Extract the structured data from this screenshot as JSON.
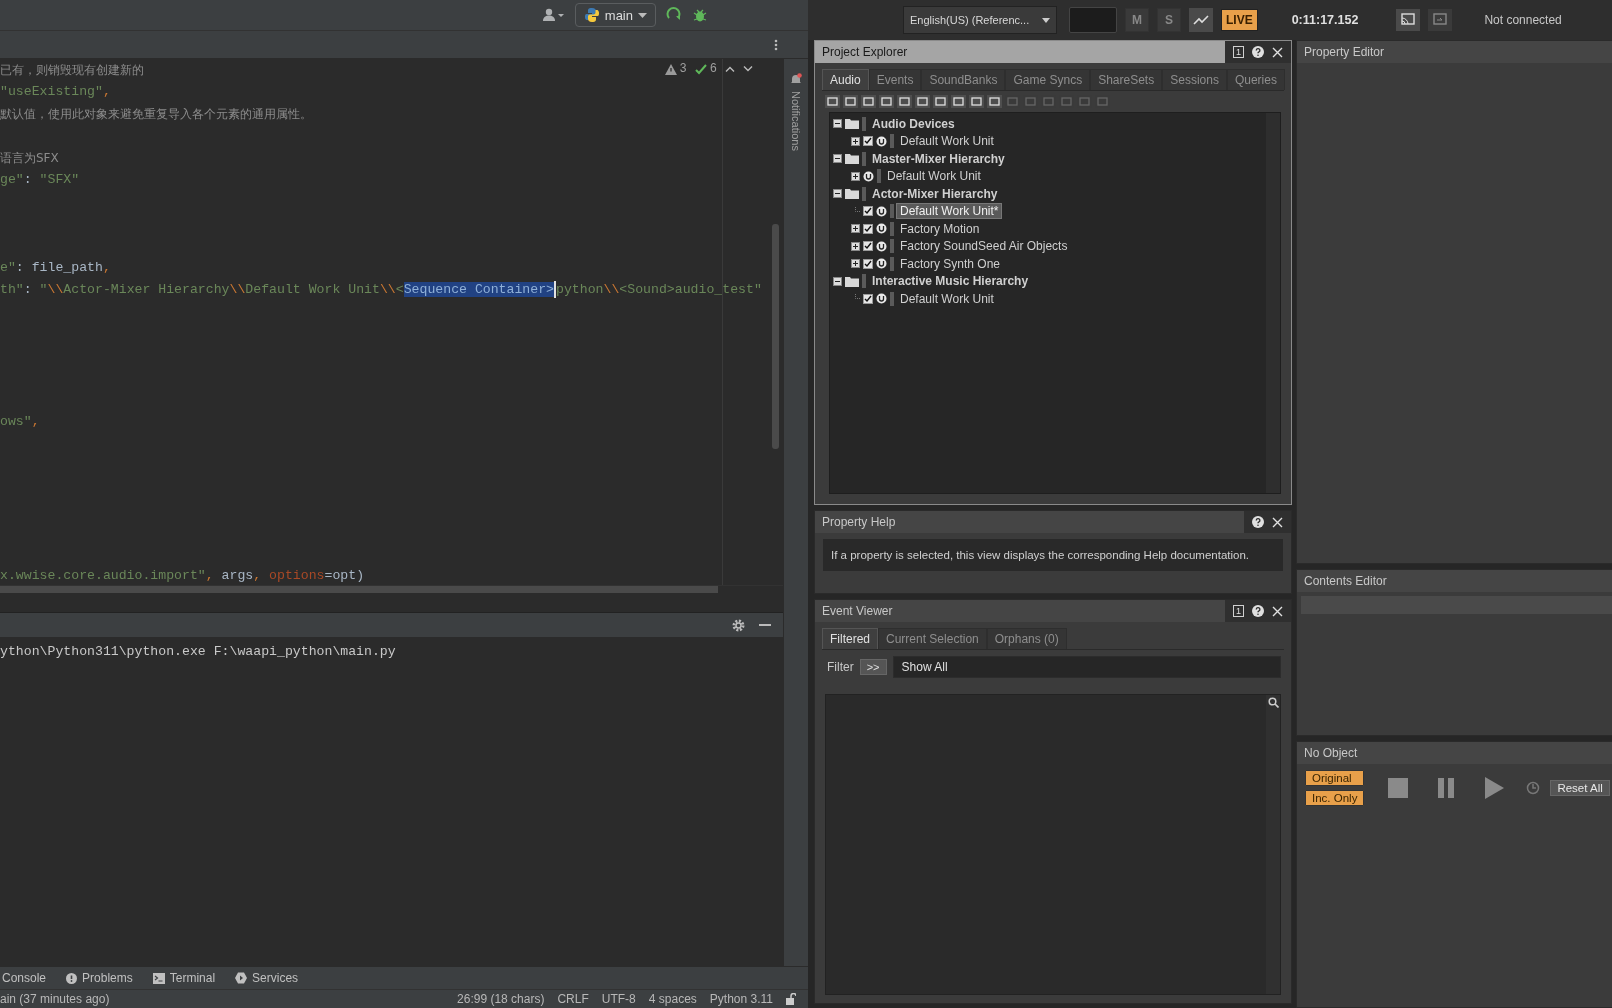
{
  "ide": {
    "branch": "main",
    "inspections": {
      "warnings": "3",
      "checks": "6"
    },
    "code_lines": [
      {
        "tokens": [
          {
            "t": "已有，则销毁现有创建新的",
            "kind": "comment"
          }
        ]
      },
      {
        "tokens": [
          {
            "t": "\"useExisting\"",
            "kind": "string"
          },
          {
            "t": ",",
            "kind": "punct"
          }
        ]
      },
      {
        "tokens": [
          {
            "t": "默认值，使用此对象来避免重复导入各个元素的通用属性。",
            "kind": "comment"
          }
        ]
      },
      {
        "tokens": [
          {
            "t": "语言为SFX",
            "kind": "comment"
          }
        ]
      },
      {
        "tokens": [
          {
            "t": "ge\"",
            "kind": "string"
          },
          {
            "t": ": ",
            "kind": "plain"
          },
          {
            "t": "\"SFX\"",
            "kind": "string"
          }
        ]
      },
      {
        "tokens": [
          {
            "t": "e\"",
            "kind": "string"
          },
          {
            "t": ": file_path",
            "kind": "plain"
          },
          {
            "t": ",",
            "kind": "punct"
          }
        ]
      },
      {
        "tokens": [
          {
            "t": "th\"",
            "kind": "string"
          },
          {
            "t": ": ",
            "kind": "plain"
          },
          {
            "t": "\"",
            "kind": "string"
          },
          {
            "t": "\\\\",
            "kind": "escape"
          },
          {
            "t": "Actor-Mixer Hierarchy",
            "kind": "string"
          },
          {
            "t": "\\\\",
            "kind": "escape"
          },
          {
            "t": "Default Work Unit",
            "kind": "string"
          },
          {
            "t": "\\\\",
            "kind": "escape"
          },
          {
            "t": "<",
            "kind": "string"
          },
          {
            "t": "Sequence Container>",
            "kind": "selection",
            "caret_after": true
          },
          {
            "t": "python",
            "kind": "string"
          },
          {
            "t": "\\\\",
            "kind": "escape"
          },
          {
            "t": "<Sound>audio_test\"",
            "kind": "string"
          }
        ]
      },
      {
        "tokens": [
          {
            "t": "ows\"",
            "kind": "string"
          },
          {
            "t": ",",
            "kind": "punct"
          }
        ]
      },
      {
        "tokens": [
          {
            "t": "x.wwise.core.audio.import\"",
            "kind": "string"
          },
          {
            "t": ", ",
            "kind": "punct"
          },
          {
            "t": "args",
            "kind": "plain"
          },
          {
            "t": ", ",
            "kind": "punct"
          },
          {
            "t": "options",
            "kind": "param"
          },
          {
            "t": "=opt)",
            "kind": "plain"
          }
        ]
      }
    ],
    "notifications_label": "Notifications",
    "run_output": [
      "ython\\Python311\\python.exe F:\\waapi_python\\main.py"
    ],
    "tool_windows": [
      {
        "label": "Console",
        "kind": "console"
      },
      {
        "label": "Problems",
        "kind": "problems"
      },
      {
        "label": "Terminal",
        "kind": "terminal"
      },
      {
        "label": "Services",
        "kind": "services"
      }
    ],
    "status_bar": {
      "vcs": "ain (37 minutes ago)",
      "items": [
        "26:99 (18 chars)",
        "CRLF",
        "UTF-8",
        "4 spaces",
        "Python 3.11"
      ]
    }
  },
  "wwise": {
    "toolbar": {
      "language": "English(US) (Referenc...",
      "mute": "M",
      "solo": "S",
      "live": "LIVE",
      "time": "0:11:17.152",
      "connection": "Not connected"
    },
    "project_explorer": {
      "title": "Project Explorer",
      "focused": true,
      "pin": "1",
      "tabs": [
        {
          "label": "Audio",
          "selected": true
        },
        {
          "label": "Events",
          "selected": false
        },
        {
          "label": "SoundBanks",
          "selected": false
        },
        {
          "label": "Game Syncs",
          "selected": false
        },
        {
          "label": "ShareSets",
          "selected": false
        },
        {
          "label": "Sessions",
          "selected": false
        },
        {
          "label": "Queries",
          "selected": false
        }
      ],
      "tree": [
        {
          "label": "Audio Devices",
          "kind": "category",
          "expanded": true,
          "selected": false,
          "children": [
            {
              "label": "Default Work Unit",
              "kind": "work_unit",
              "expanded": false,
              "checked": true,
              "selected": false
            }
          ]
        },
        {
          "label": "Master-Mixer Hierarchy",
          "kind": "category",
          "expanded": true,
          "selected": false,
          "children": [
            {
              "label": "Default Work Unit",
              "kind": "work_unit",
              "expanded": false,
              "selected": false
            }
          ]
        },
        {
          "label": "Actor-Mixer Hierarchy",
          "kind": "category",
          "expanded": true,
          "selected": false,
          "children": [
            {
              "label": "Default Work Unit*",
              "kind": "work_unit",
              "checked": true,
              "selected": true
            },
            {
              "label": "Factory Motion",
              "kind": "work_unit",
              "expanded": false,
              "checked": true,
              "selected": false
            },
            {
              "label": "Factory SoundSeed Air Objects",
              "kind": "work_unit",
              "expanded": false,
              "checked": true,
              "selected": false
            },
            {
              "label": "Factory Synth One",
              "kind": "work_unit",
              "expanded": false,
              "checked": true,
              "selected": false
            }
          ]
        },
        {
          "label": "Interactive Music Hierarchy",
          "kind": "category",
          "expanded": true,
          "selected": false,
          "children": [
            {
              "label": "Default Work Unit",
              "kind": "work_unit",
              "checked": true,
              "selected": false
            }
          ]
        }
      ]
    },
    "property_help": {
      "title": "Property Help",
      "focused": false,
      "text": "If a property is selected, this view displays the corresponding Help documentation."
    },
    "event_viewer": {
      "title": "Event Viewer",
      "focused": false,
      "pin": "1",
      "tabs": [
        {
          "label": "Filtered",
          "selected": true
        },
        {
          "label": "Current Selection",
          "selected": false
        },
        {
          "label": "Orphans (0)",
          "selected": false
        }
      ],
      "filter_label": "Filter",
      "filter_button": ">>",
      "filter_value": "Show All"
    },
    "property_editor": {
      "title": "Property Editor"
    },
    "contents_editor": {
      "title": "Contents Editor"
    },
    "transport": {
      "title": "No Object",
      "modes": [
        {
          "label": "Original",
          "on": true
        },
        {
          "label": "Inc. Only",
          "on": true
        }
      ],
      "reset": "Reset All"
    }
  }
}
